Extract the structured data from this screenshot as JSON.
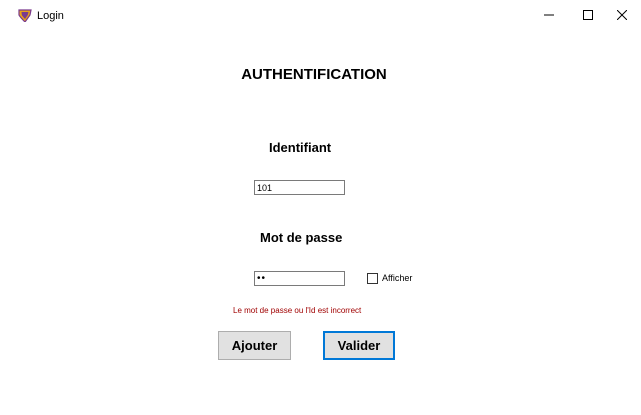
{
  "window": {
    "title": "Login",
    "icon": "app-shield-icon",
    "controls": {
      "minimize": "minimize-icon",
      "maximize": "maximize-icon",
      "close": "close-icon"
    }
  },
  "form": {
    "heading": "AUTHENTIFICATION",
    "id_label": "Identifiant",
    "id_value": "101",
    "password_label": "Mot de passe",
    "password_value": "••",
    "show_password_label": "Afficher",
    "show_password_checked": false,
    "error_message": "Le mot de passe ou l'Id est incorrect",
    "add_button": "Ajouter",
    "submit_button": "Valider"
  },
  "colors": {
    "error": "#a00000",
    "focus_border": "#0078d7",
    "button_bg": "#e1e1e1"
  }
}
